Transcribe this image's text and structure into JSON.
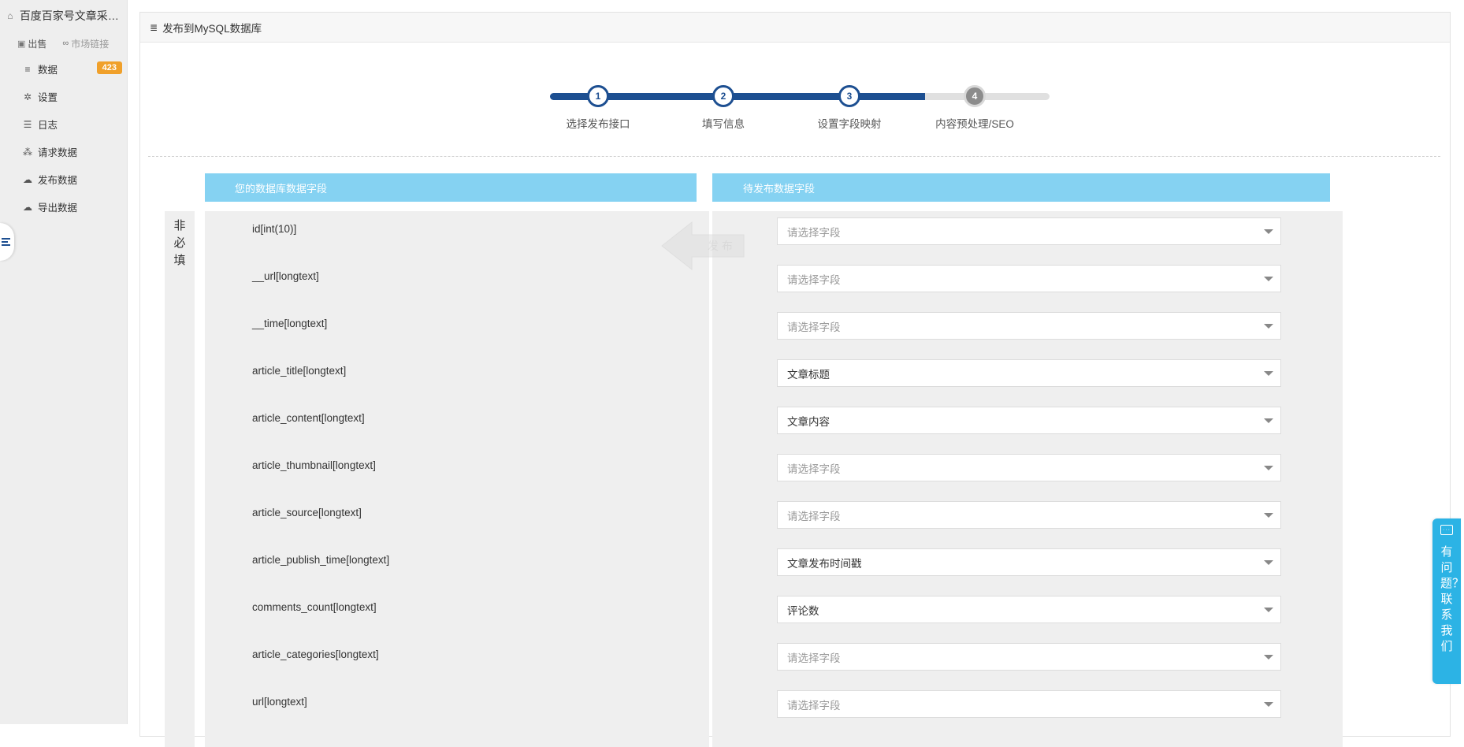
{
  "sidebar": {
    "title": "百度百家号文章采集...",
    "links": [
      {
        "label": "出售",
        "icon": "shop-icon"
      },
      {
        "label": "市场链接",
        "icon": "link-icon"
      }
    ],
    "items": [
      {
        "label": "数据",
        "icon": "database-icon",
        "badge": "423"
      },
      {
        "label": "设置",
        "icon": "gear-icon"
      },
      {
        "label": "日志",
        "icon": "list-icon"
      },
      {
        "label": "请求数据",
        "icon": "share-icon"
      },
      {
        "label": "发布数据",
        "icon": "cloud-upload-icon"
      },
      {
        "label": "导出数据",
        "icon": "cloud-download-icon"
      }
    ]
  },
  "panel": {
    "title": "发布到MySQL数据库"
  },
  "steps": [
    {
      "num": "1",
      "label": "选择发布接口",
      "done": true
    },
    {
      "num": "2",
      "label": "填写信息",
      "done": true
    },
    {
      "num": "3",
      "label": "设置字段映射",
      "done": true
    },
    {
      "num": "4",
      "label": "内容预处理/SEO",
      "done": false
    }
  ],
  "mapping": {
    "left_header": "您的数据库数据字段",
    "right_header": "待发布数据字段",
    "side_label": [
      "非",
      "必",
      "填"
    ],
    "watermark": "发 布",
    "rows": [
      {
        "field": "id[int(10)]",
        "value": "请选择字段",
        "empty": true
      },
      {
        "field": "__url[longtext]",
        "value": "请选择字段",
        "empty": true
      },
      {
        "field": "__time[longtext]",
        "value": "请选择字段",
        "empty": true
      },
      {
        "field": "article_title[longtext]",
        "value": "文章标题",
        "empty": false
      },
      {
        "field": "article_content[longtext]",
        "value": "文章内容",
        "empty": false
      },
      {
        "field": "article_thumbnail[longtext]",
        "value": "请选择字段",
        "empty": true
      },
      {
        "field": "article_source[longtext]",
        "value": "请选择字段",
        "empty": true
      },
      {
        "field": "article_publish_time[longtext]",
        "value": "文章发布时间戳",
        "empty": false
      },
      {
        "field": "comments_count[longtext]",
        "value": "评论数",
        "empty": false
      },
      {
        "field": "article_categories[longtext]",
        "value": "请选择字段",
        "empty": true
      },
      {
        "field": "url[longtext]",
        "value": "请选择字段",
        "empty": true
      }
    ]
  },
  "help": {
    "text": "有问题？联系我们"
  },
  "colors": {
    "primary": "#1d4f91",
    "header_blue": "#85d2f2",
    "badge": "#f0a02a",
    "help": "#2cb3e5"
  }
}
